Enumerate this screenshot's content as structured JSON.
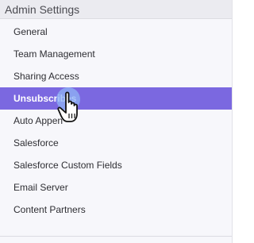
{
  "panel": {
    "title": "Admin Settings",
    "items": [
      {
        "label": "General",
        "active": false
      },
      {
        "label": "Team Management",
        "active": false
      },
      {
        "label": "Sharing Access",
        "active": false
      },
      {
        "label": "Unsubscribes",
        "active": true
      },
      {
        "label": "Auto Appen",
        "active": false
      },
      {
        "label": "Salesforce",
        "active": false
      },
      {
        "label": "Salesforce Custom Fields",
        "active": false
      },
      {
        "label": "Email Server",
        "active": false
      },
      {
        "label": "Content Partners",
        "active": false
      }
    ]
  },
  "colors": {
    "active_background": "#7b68e0",
    "active_text": "#ffffff",
    "click_highlight": "#8fb4f5"
  },
  "icons": {
    "cursor": "hand-pointer-icon"
  }
}
